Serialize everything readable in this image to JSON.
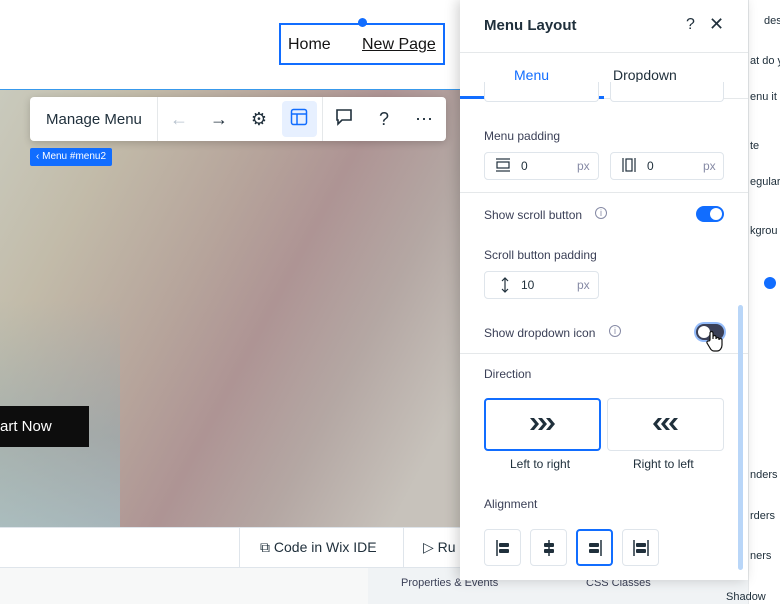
{
  "site": {
    "menu_items": [
      "Home",
      "New Page"
    ],
    "cta_label": "art Now",
    "menu_tag": "‹ Menu #menu2"
  },
  "toolbar": {
    "manage_label": "Manage Menu",
    "icons": [
      "arrow-left-icon",
      "arrow-right-icon",
      "gear-icon",
      "layout-icon",
      "comment-icon",
      "help-icon",
      "more-icon"
    ]
  },
  "bottom_bar": {
    "code_ide": "Code in Wix IDE",
    "run": "Ru"
  },
  "bottom_panel": {
    "tab_properties": "Properties & Events",
    "tab_css": "CSS Classes"
  },
  "right_side_cut": [
    "des",
    "at do y",
    "enu it",
    "te",
    "egular",
    "kgrou",
    "nders",
    "rders",
    "ners",
    "Shadow"
  ],
  "panel": {
    "title": "Menu Layout",
    "help": "?",
    "close": "✕",
    "tabs": [
      "Menu",
      "Dropdown"
    ],
    "menu_padding_label": "Menu padding",
    "menu_padding_v": "0",
    "menu_padding_h": "0",
    "unit": "px",
    "show_scroll_label": "Show scroll button",
    "show_scroll_on": true,
    "scroll_padding_label": "Scroll button padding",
    "scroll_padding_value": "10",
    "show_dropdown_label": "Show dropdown icon",
    "show_dropdown_on": false,
    "direction_label": "Direction",
    "directions": [
      "Left to right",
      "Right to left"
    ],
    "direction_selected": "Left to right",
    "alignment_label": "Alignment",
    "alignment_options": [
      "align-left-icon",
      "align-center-icon",
      "align-right-icon",
      "align-justify-icon"
    ],
    "alignment_selected": "align-right-icon",
    "accent": "#116dff"
  }
}
